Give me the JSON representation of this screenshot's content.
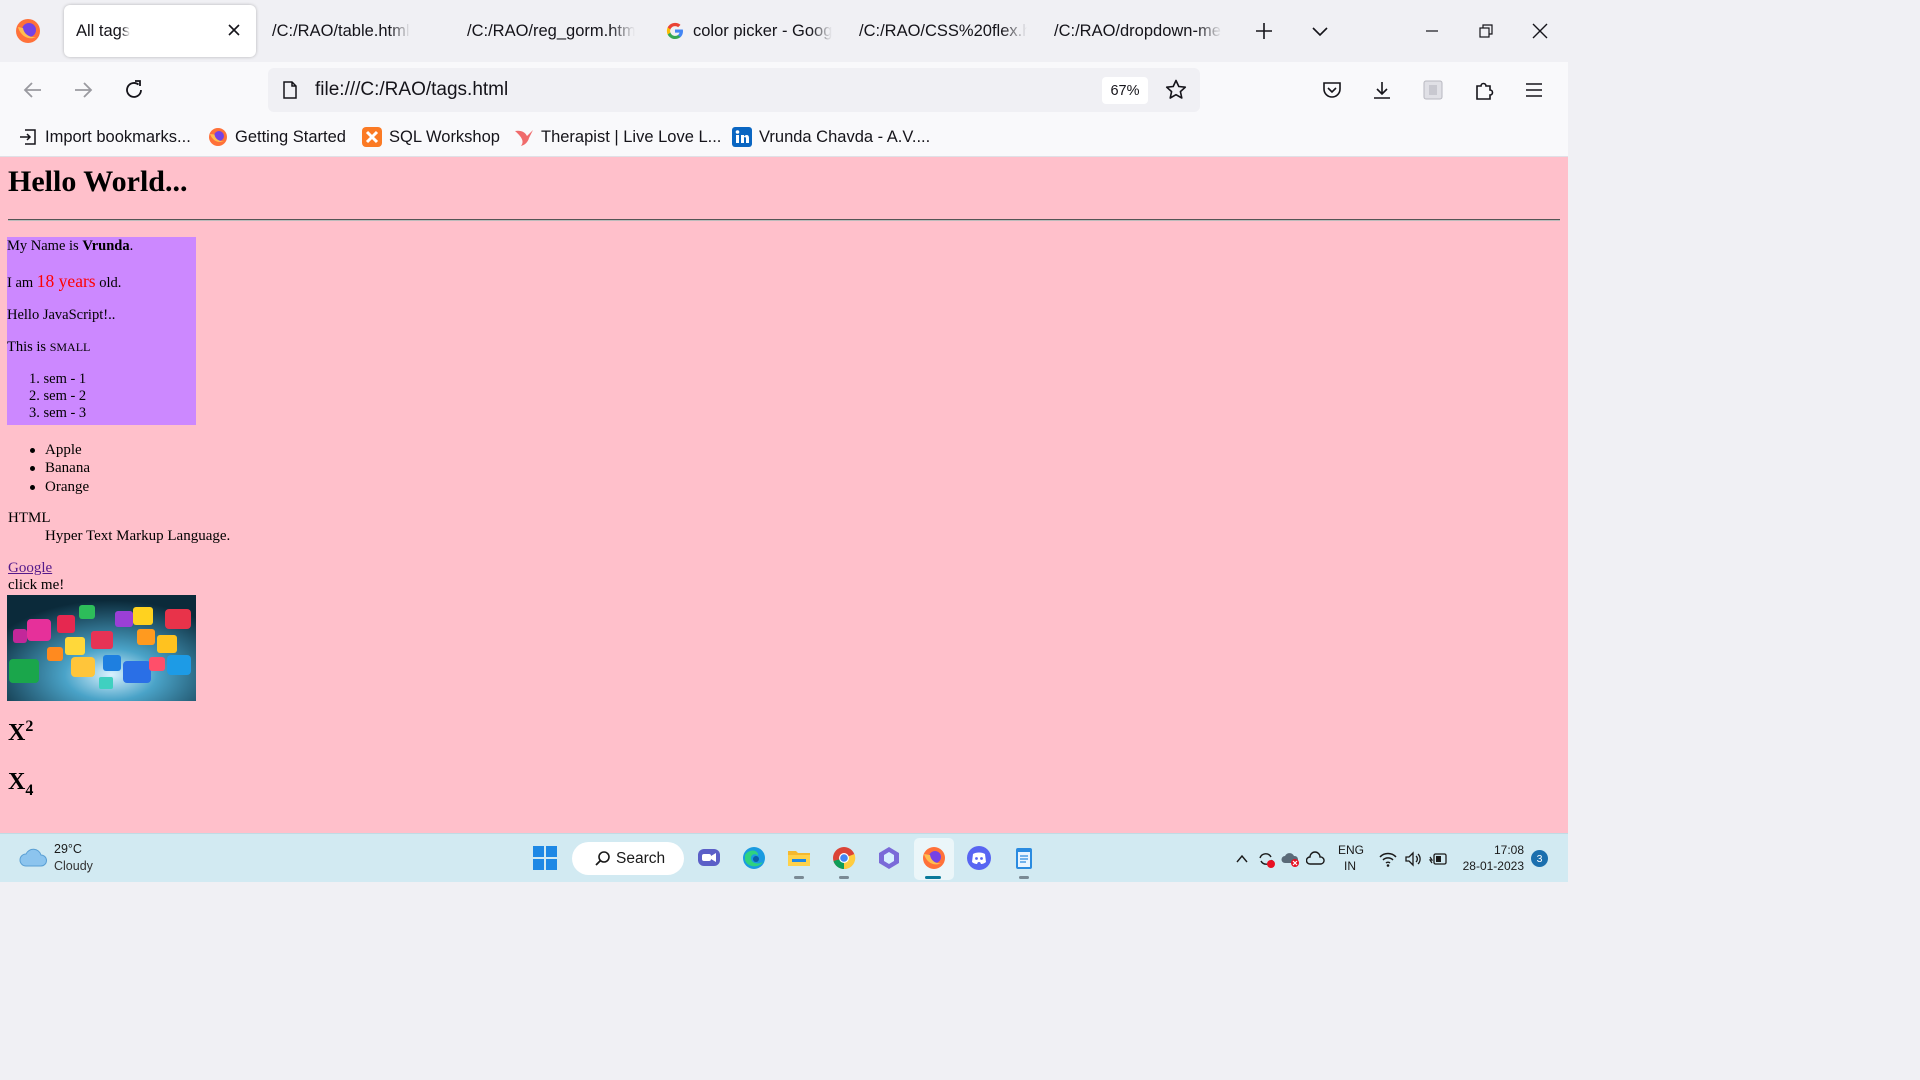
{
  "browser": {
    "tabs": [
      {
        "label": "All tags",
        "active": true
      },
      {
        "label": "/C:/RAO/table.html"
      },
      {
        "label": "/C:/RAO/reg_gorm.html"
      },
      {
        "label": "color picker - Google Search",
        "icon": "google-icon"
      },
      {
        "label": "/C:/RAO/CSS%20flex.html"
      },
      {
        "label": "/C:/RAO/dropdown-menu.html"
      }
    ],
    "url": "file:///C:/RAO/tags.html",
    "zoom": "67%",
    "bookmarks": [
      {
        "label": "Import bookmarks...",
        "icon": "import-icon"
      },
      {
        "label": "Getting Started",
        "icon": "firefox-icon"
      },
      {
        "label": "SQL Workshop",
        "icon": "xampp-icon"
      },
      {
        "label": "Therapist | Live Love L...",
        "icon": "bird-icon"
      },
      {
        "label": "Vrunda Chavda - A.V....",
        "icon": "linkedin-icon"
      }
    ]
  },
  "page": {
    "title": "Hello World...",
    "name_prefix": "My Name is ",
    "name": "Vrunda",
    "name_suffix": ".",
    "age_prefix": "I am ",
    "age": "18 years",
    "age_suffix": " old.",
    "js_line": "Hello JavaScript!..",
    "small_prefix": "This is ",
    "small_word": "small",
    "ordered_list": [
      "sem - 1",
      "sem - 2",
      "sem - 3"
    ],
    "unordered_list": [
      "Apple",
      "Banana",
      "Orange"
    ],
    "dt": "HTML",
    "dd": "Hyper Text Markup Language.",
    "link_text": "Google",
    "click_text": "click me!",
    "sup_base": "X",
    "sup_value": "2",
    "sub_base": "X",
    "sub_value": "4",
    "background_color": "#ffc0cb",
    "box_color": "#cc88ff"
  },
  "taskbar": {
    "temperature": "29°C",
    "condition": "Cloudy",
    "search_label": "Search",
    "language": "ENG",
    "region": "IN",
    "time": "17:08",
    "date": "28-01-2023",
    "notifications": "3"
  }
}
